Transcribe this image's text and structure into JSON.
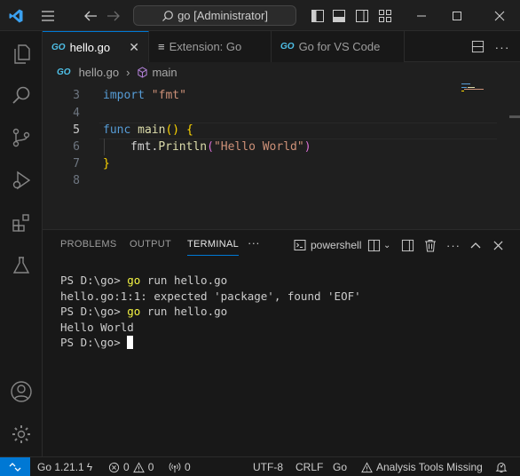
{
  "titlebar": {
    "search_text": "go [Administrator]"
  },
  "tabs": [
    {
      "label": "hello.go",
      "active": true
    },
    {
      "label": "Extension: Go",
      "active": false
    },
    {
      "label": "Go for VS Code",
      "active": false
    }
  ],
  "tab_icons": {
    "go_badge": "GO",
    "ext_icon": "≡"
  },
  "breadcrumb": {
    "file": "hello.go",
    "symbol": "main"
  },
  "editor": {
    "lines": [
      {
        "num": "3"
      },
      {
        "num": "4"
      },
      {
        "num": "5"
      },
      {
        "num": "6"
      },
      {
        "num": "7"
      },
      {
        "num": "8"
      }
    ],
    "tokens": {
      "import_kw": "import",
      "fmt_str": "\"fmt\"",
      "func_kw": "func",
      "main_fn": "main",
      "paren_open": "(",
      "paren_close": ")",
      "brace_open": "{",
      "fmt_pkg": "fmt.",
      "println_fn": "Println",
      "p_open": "(",
      "hello_str": "\"Hello World\"",
      "p_close": ")",
      "brace_close": "}"
    }
  },
  "panel": {
    "tabs": [
      "PROBLEMS",
      "OUTPUT",
      "TERMINAL"
    ],
    "more": "···",
    "shell": "powershell"
  },
  "terminal": {
    "prompt": "PS D:\\go> ",
    "cmd1": "go",
    "cmd1_rest": " run hello.go",
    "error": "hello.go:1:1: expected 'package', found 'EOF'",
    "cmd2": "go",
    "cmd2_rest": " run hello.go",
    "output": "Hello World"
  },
  "statusbar": {
    "go_version": "Go 1.21.1",
    "errors": "0",
    "warnings": "0",
    "ports": "0",
    "encoding": "UTF-8",
    "eol": "CRLF",
    "language": "Go",
    "analysis": "Analysis Tools Missing"
  },
  "colors": {
    "accent": "#0078d4",
    "background": "#1f1f1f",
    "keyword": "#569cd6",
    "string": "#ce9178",
    "function": "#dcdcaa"
  }
}
